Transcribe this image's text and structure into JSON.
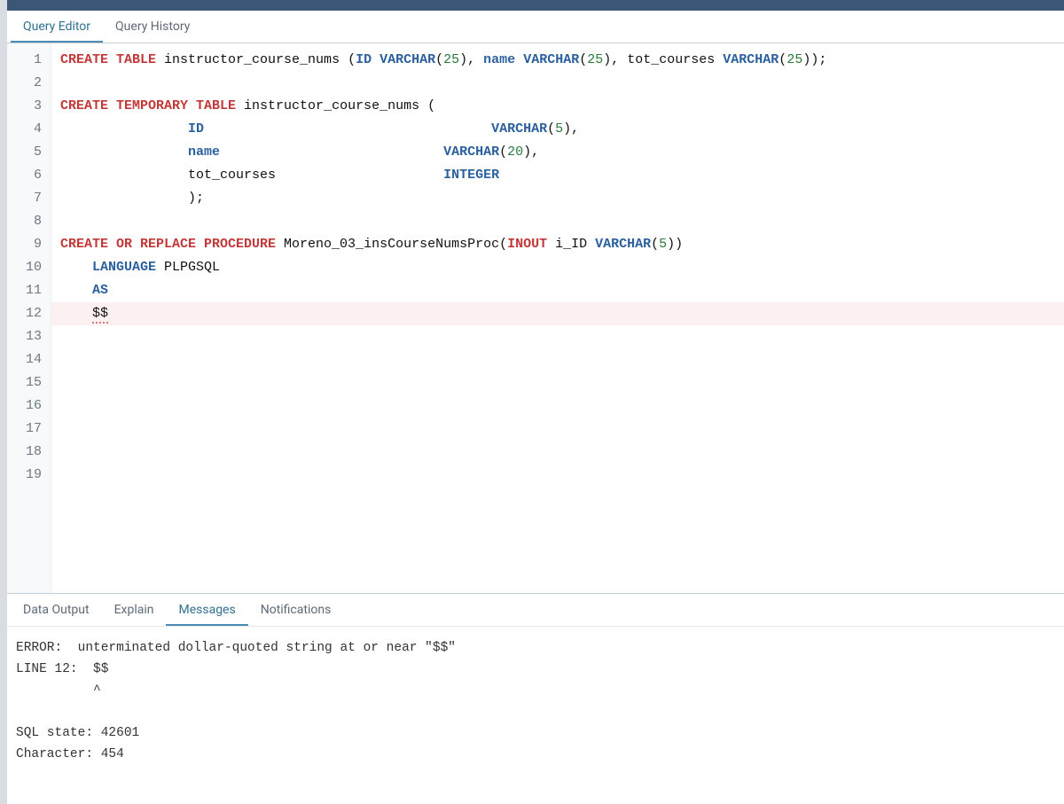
{
  "top_tabs": {
    "editor": "Query Editor",
    "history": "Query History"
  },
  "code_lines": [
    {
      "n": 1,
      "error": false,
      "segments": [
        {
          "t": "CREATE TABLE",
          "c": "kw-create"
        },
        {
          "t": " instructor_course_nums (",
          "c": "ident"
        },
        {
          "t": "ID",
          "c": "kw-blue"
        },
        {
          "t": " ",
          "c": "ident"
        },
        {
          "t": "VARCHAR",
          "c": "kw-blue"
        },
        {
          "t": "(",
          "c": "ident"
        },
        {
          "t": "25",
          "c": "num"
        },
        {
          "t": "), ",
          "c": "ident"
        },
        {
          "t": "name",
          "c": "kw-blue"
        },
        {
          "t": " ",
          "c": "ident"
        },
        {
          "t": "VARCHAR",
          "c": "kw-blue"
        },
        {
          "t": "(",
          "c": "ident"
        },
        {
          "t": "25",
          "c": "num"
        },
        {
          "t": "), tot_courses ",
          "c": "ident"
        },
        {
          "t": "VARCHAR",
          "c": "kw-blue"
        },
        {
          "t": "(",
          "c": "ident"
        },
        {
          "t": "25",
          "c": "num"
        },
        {
          "t": "));",
          "c": "ident"
        }
      ]
    },
    {
      "n": 2,
      "error": false,
      "segments": []
    },
    {
      "n": 3,
      "error": false,
      "segments": [
        {
          "t": "CREATE TEMPORARY TABLE",
          "c": "kw-create"
        },
        {
          "t": " instructor_course_nums (",
          "c": "ident"
        }
      ]
    },
    {
      "n": 4,
      "error": false,
      "segments": [
        {
          "t": "                ",
          "c": "ident"
        },
        {
          "t": "ID",
          "c": "kw-blue"
        },
        {
          "t": "                                    ",
          "c": "ident"
        },
        {
          "t": "VARCHAR",
          "c": "kw-blue"
        },
        {
          "t": "(",
          "c": "ident"
        },
        {
          "t": "5",
          "c": "num"
        },
        {
          "t": "),",
          "c": "ident"
        }
      ]
    },
    {
      "n": 5,
      "error": false,
      "segments": [
        {
          "t": "                ",
          "c": "ident"
        },
        {
          "t": "name",
          "c": "kw-blue"
        },
        {
          "t": "                            ",
          "c": "ident"
        },
        {
          "t": "VARCHAR",
          "c": "kw-blue"
        },
        {
          "t": "(",
          "c": "ident"
        },
        {
          "t": "20",
          "c": "num"
        },
        {
          "t": "),",
          "c": "ident"
        }
      ]
    },
    {
      "n": 6,
      "error": false,
      "segments": [
        {
          "t": "                tot_courses                     ",
          "c": "ident"
        },
        {
          "t": "INTEGER",
          "c": "kw-blue"
        }
      ]
    },
    {
      "n": 7,
      "error": false,
      "segments": [
        {
          "t": "                );",
          "c": "ident"
        }
      ]
    },
    {
      "n": 8,
      "error": false,
      "segments": []
    },
    {
      "n": 9,
      "error": false,
      "segments": [
        {
          "t": "CREATE OR REPLACE PROCEDURE",
          "c": "kw-create"
        },
        {
          "t": " Moreno_03_insCourseNumsProc(",
          "c": "ident"
        },
        {
          "t": "INOUT",
          "c": "kw-inout"
        },
        {
          "t": " i_ID ",
          "c": "ident"
        },
        {
          "t": "VARCHAR",
          "c": "kw-blue"
        },
        {
          "t": "(",
          "c": "ident"
        },
        {
          "t": "5",
          "c": "num"
        },
        {
          "t": "))",
          "c": "ident"
        }
      ]
    },
    {
      "n": 10,
      "error": false,
      "segments": [
        {
          "t": "    ",
          "c": "ident"
        },
        {
          "t": "LANGUAGE",
          "c": "kw-blue"
        },
        {
          "t": " PLPGSQL",
          "c": "ident"
        }
      ]
    },
    {
      "n": 11,
      "error": false,
      "segments": [
        {
          "t": "    ",
          "c": "ident"
        },
        {
          "t": "AS",
          "c": "kw-blue"
        }
      ]
    },
    {
      "n": 12,
      "error": true,
      "segments": [
        {
          "t": "    ",
          "c": "ident"
        },
        {
          "t": "$$",
          "c": "ident",
          "err": true
        }
      ]
    },
    {
      "n": 13,
      "error": false,
      "segments": []
    },
    {
      "n": 14,
      "error": false,
      "segments": []
    },
    {
      "n": 15,
      "error": false,
      "segments": []
    },
    {
      "n": 16,
      "error": false,
      "segments": []
    },
    {
      "n": 17,
      "error": false,
      "segments": []
    },
    {
      "n": 18,
      "error": false,
      "segments": []
    },
    {
      "n": 19,
      "error": false,
      "segments": []
    }
  ],
  "bottom_tabs": {
    "data_output": "Data Output",
    "explain": "Explain",
    "messages": "Messages",
    "notifications": "Notifications"
  },
  "messages_text": "ERROR:  unterminated dollar-quoted string at or near \"$$\"\nLINE 12:  $$\n          ^\n\nSQL state: 42601\nCharacter: 454"
}
